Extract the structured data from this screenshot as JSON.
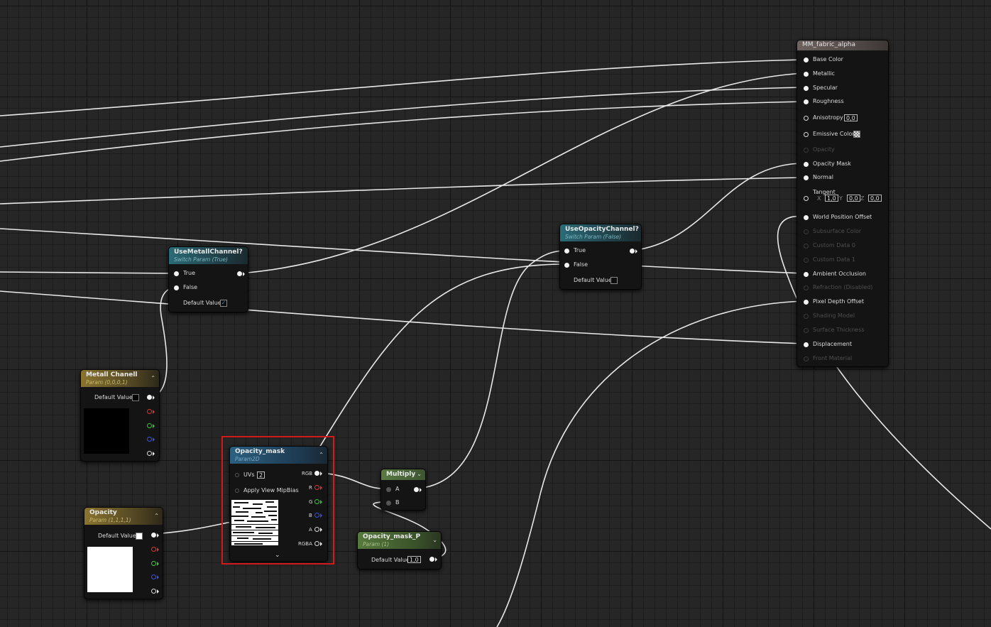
{
  "material_node": {
    "title": "MM_fabric_alpha",
    "pins": [
      {
        "label": "Base Color",
        "enabled": true
      },
      {
        "label": "Metallic",
        "enabled": true
      },
      {
        "label": "Specular",
        "enabled": true
      },
      {
        "label": "Roughness",
        "enabled": true
      },
      {
        "label": "Anisotropy",
        "enabled": true,
        "value": "0,0"
      },
      {
        "label": "Emissive Color",
        "enabled": true
      },
      {
        "label": "Opacity",
        "enabled": false
      },
      {
        "label": "Opacity Mask",
        "enabled": true
      },
      {
        "label": "Normal",
        "enabled": true
      },
      {
        "label": "Tangent",
        "enabled": true,
        "x": "1,0",
        "y": "0,0",
        "z": "0,0"
      },
      {
        "label": "World Position Offset",
        "enabled": true
      },
      {
        "label": "Subsurface Color",
        "enabled": false
      },
      {
        "label": "Custom Data 0",
        "enabled": false
      },
      {
        "label": "Custom Data 1",
        "enabled": false
      },
      {
        "label": "Ambient Occlusion",
        "enabled": true
      },
      {
        "label": "Refraction (Disabled)",
        "enabled": false
      },
      {
        "label": "Pixel Depth Offset",
        "enabled": true
      },
      {
        "label": "Shading Model",
        "enabled": false
      },
      {
        "label": "Surface Thickness",
        "enabled": false
      },
      {
        "label": "Displacement",
        "enabled": true
      },
      {
        "label": "Front Material",
        "enabled": false
      }
    ],
    "axis_labels": {
      "x": "X",
      "y": "Y",
      "z": "Z"
    }
  },
  "use_metall_channel": {
    "title": "UseMetallChannel?",
    "subtitle": "Switch Param (True)",
    "true_label": "True",
    "false_label": "False",
    "default_label": "Default Value",
    "default_checked": true
  },
  "use_opacity_channel": {
    "title": "UseOpacityChannel?",
    "subtitle": "Switch Param (False)",
    "true_label": "True",
    "false_label": "False",
    "default_label": "Default Value",
    "default_checked": false
  },
  "metall_chanell": {
    "title": "Metall Chanell",
    "subtitle": "Param (0,0,0,1)",
    "default_label": "Default Value",
    "color": "#000000"
  },
  "opacity": {
    "title": "Opacity",
    "subtitle": "Param (1,1,1,1)",
    "default_label": "Default Value",
    "color": "#ffffff"
  },
  "opacity_mask": {
    "title": "Opacity_mask",
    "subtitle": "Param2D",
    "uvs_label": "UVs",
    "uvs_value": "2",
    "mip_label": "Apply View MipBias",
    "outputs": [
      "RGB",
      "R",
      "G",
      "B",
      "A",
      "RGBA"
    ]
  },
  "multiply": {
    "title": "Multiply",
    "input_a": "A",
    "input_b": "B"
  },
  "opacity_mask_p": {
    "title": "Opacity_mask_P",
    "subtitle": "Param (1)",
    "default_label": "Default Value",
    "value": "1,0"
  },
  "colors": {
    "selection": "#d41b1b",
    "wire": "#e8e8e8",
    "pin_r": "#e03333",
    "pin_g": "#33c833",
    "pin_b": "#3b4fe0"
  }
}
